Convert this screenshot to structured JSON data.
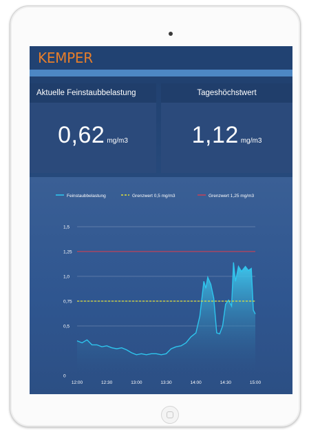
{
  "app": {
    "brand": "KEMPER"
  },
  "cards": [
    {
      "title": "Aktuelle Feinstaubbelastung",
      "value": "0,62",
      "unit": "mg/m3"
    },
    {
      "title": "Tageshöchstwert",
      "value": "1,12",
      "unit": "mg/m3"
    }
  ],
  "colors": {
    "brand": "#e77e2a",
    "series": "#2ec6ee",
    "limit1": "#e2e23a",
    "limit2": "#c0435a"
  },
  "chart_data": {
    "type": "area",
    "legend_position": "top",
    "legend": [
      {
        "label": "Feinstaubbelastung",
        "style": "solid",
        "color": "#2ec6ee"
      },
      {
        "label": "Grenzwert 0,5 mg/m3",
        "style": "dashed",
        "color": "#e2e23a"
      },
      {
        "label": "Grenzwert 1,25 mg/m3",
        "style": "solid",
        "color": "#c0435a"
      }
    ],
    "y_ticks": [
      "0",
      "0,5",
      "0,75",
      "1,0",
      "1,25",
      "1,5"
    ],
    "y_tick_values": [
      0,
      0.5,
      0.75,
      1.0,
      1.25,
      1.5
    ],
    "x_ticks": [
      "12:00",
      "12:30",
      "13:00",
      "13:30",
      "14:00",
      "14:30",
      "15:00"
    ],
    "x_tick_values": [
      0,
      30,
      60,
      90,
      120,
      150,
      180
    ],
    "xlim": [
      0,
      180
    ],
    "ylim": [
      0,
      1.5
    ],
    "grid": true,
    "thresholds": [
      0.75,
      1.25
    ],
    "series": [
      {
        "name": "Feinstaubbelastung",
        "x": [
          0,
          5,
          10,
          15,
          20,
          25,
          30,
          35,
          40,
          45,
          50,
          55,
          60,
          65,
          70,
          75,
          80,
          85,
          90,
          95,
          100,
          105,
          110,
          115,
          120,
          124,
          128,
          130,
          132,
          135,
          138,
          141,
          144,
          147,
          150,
          153,
          156,
          158,
          160,
          163,
          166,
          170,
          173,
          176,
          178,
          180
        ],
        "y": [
          0.35,
          0.33,
          0.36,
          0.31,
          0.31,
          0.29,
          0.3,
          0.28,
          0.27,
          0.28,
          0.26,
          0.23,
          0.21,
          0.22,
          0.21,
          0.22,
          0.22,
          0.21,
          0.22,
          0.27,
          0.29,
          0.3,
          0.33,
          0.39,
          0.43,
          0.6,
          0.95,
          0.88,
          0.99,
          0.92,
          0.78,
          0.43,
          0.42,
          0.5,
          0.72,
          0.76,
          0.7,
          1.14,
          0.95,
          1.1,
          1.05,
          1.1,
          1.06,
          1.08,
          0.66,
          0.62
        ]
      }
    ]
  }
}
